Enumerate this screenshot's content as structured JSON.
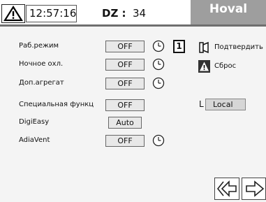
{
  "header": {
    "time": "12:57:16",
    "dz_label": "DZ :",
    "dz_value": "34",
    "brand": "Hoval"
  },
  "rows": [
    {
      "label": "Раб.режим",
      "value": "OFF",
      "has_clock": true
    },
    {
      "label": "Ночное охл.",
      "value": "OFF",
      "has_clock": true
    },
    {
      "label": "Доп.агрегат",
      "value": "OFF",
      "has_clock": true
    },
    {
      "label": "Специальная функц",
      "value": "OFF",
      "has_clock": false
    },
    {
      "label": "DigiEasy",
      "value": "Auto",
      "has_clock": false
    },
    {
      "label": "AdiaVent",
      "value": "OFF",
      "has_clock": true
    }
  ],
  "one_button": "1",
  "confirm_label": "Подтвердить",
  "reset_label": "Сброс",
  "mode_letter": "L",
  "mode_value": "Local",
  "colors": {
    "brand_bg": "#9e9e9e",
    "divider": "#6f6f6f",
    "value_bg": "#e8e8e8"
  }
}
